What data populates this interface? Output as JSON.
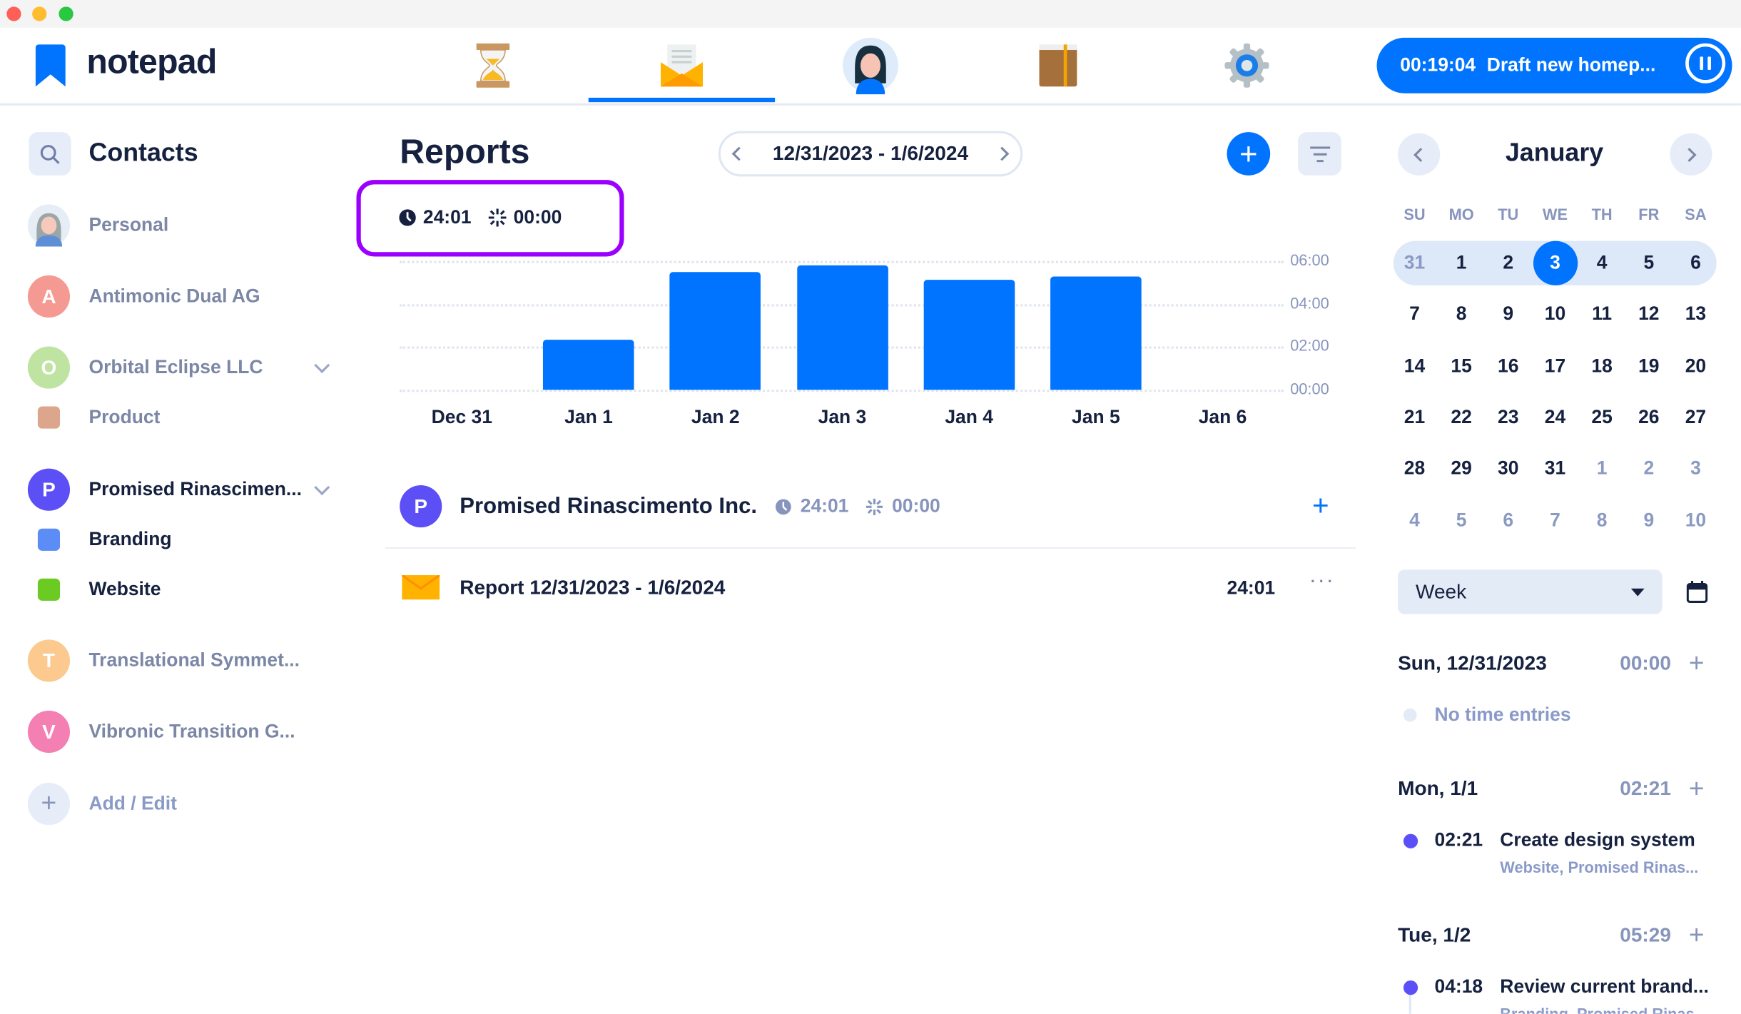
{
  "app": {
    "name": "notepad",
    "brand_color": "#0074ff"
  },
  "nav": {
    "tabs": [
      {
        "icon": "hourglass-icon",
        "active": false
      },
      {
        "icon": "envelope-icon",
        "active": true
      },
      {
        "icon": "avatar-icon",
        "active": false
      },
      {
        "icon": "book-icon",
        "active": false
      },
      {
        "icon": "gear-icon",
        "active": false
      }
    ]
  },
  "timer": {
    "time": "00:19:04",
    "task": "Draft new homep..."
  },
  "sidebar": {
    "title": "Contacts",
    "items": [
      {
        "label": "Personal",
        "type": "avatar-photo",
        "muted": true
      },
      {
        "label": "Antimonic Dual AG",
        "initial": "A",
        "color": "#f59a93",
        "muted": true
      },
      {
        "label": "Orbital Eclipse LLC",
        "initial": "O",
        "color": "#bfe3a1",
        "muted": true,
        "expandable": true
      },
      {
        "label": "Product",
        "color": "#dba68b",
        "muted": true,
        "project": true
      },
      {
        "label": "Promised Rinascimen...",
        "initial": "P",
        "color": "#5b4ff5",
        "muted": false,
        "expandable": true
      },
      {
        "label": "Branding",
        "color": "#5c8df6",
        "muted": false,
        "project": true
      },
      {
        "label": "Website",
        "color": "#6bcb23",
        "muted": false,
        "project": true
      },
      {
        "label": "Translational Symmet...",
        "initial": "T",
        "color": "#fcc98f",
        "muted": true
      },
      {
        "label": "Vibronic Transition G...",
        "initial": "V",
        "color": "#f47fb3",
        "muted": true
      }
    ],
    "add_label": "Add / Edit"
  },
  "main": {
    "title": "Reports",
    "date_range": "12/31/2023 - 1/6/2024",
    "total_time": "24:01",
    "break_time": "00:00",
    "client": {
      "initial": "P",
      "name": "Promised Rinascimento Inc.",
      "time": "24:01",
      "break": "00:00"
    },
    "report": {
      "name": "Report 12/31/2023 - 1/6/2024",
      "time": "24:01"
    }
  },
  "chart_data": {
    "type": "bar",
    "categories": [
      "Dec 31",
      "Jan 1",
      "Jan 2",
      "Jan 3",
      "Jan 4",
      "Jan 5",
      "Jan 6"
    ],
    "values_hours": [
      0,
      2.35,
      5.48,
      5.8,
      5.1,
      5.28,
      0
    ],
    "y_ticks": [
      "00:00",
      "02:00",
      "04:00",
      "06:00"
    ],
    "ylim_hours": [
      0,
      6
    ],
    "grid": true,
    "bar_color": "#0074ff"
  },
  "calendar": {
    "month": "January",
    "weekdays": [
      "SU",
      "MO",
      "TU",
      "WE",
      "TH",
      "FR",
      "SA"
    ],
    "weeks": [
      [
        "31",
        "1",
        "2",
        "3",
        "4",
        "5",
        "6"
      ],
      [
        "7",
        "8",
        "9",
        "10",
        "11",
        "12",
        "13"
      ],
      [
        "14",
        "15",
        "16",
        "17",
        "18",
        "19",
        "20"
      ],
      [
        "21",
        "22",
        "23",
        "24",
        "25",
        "26",
        "27"
      ],
      [
        "28",
        "29",
        "30",
        "31",
        "1",
        "2",
        "3"
      ],
      [
        "4",
        "5",
        "6",
        "7",
        "8",
        "9",
        "10"
      ]
    ],
    "today": "3",
    "selected_week_index": 0,
    "view": "Week"
  },
  "days": [
    {
      "label": "Sun, 12/31/2023",
      "total": "00:00",
      "empty_text": "No time entries",
      "entries": []
    },
    {
      "label": "Mon, 1/1",
      "total": "02:21",
      "entries": [
        {
          "time": "02:21",
          "title": "Create design system",
          "sub": "Website, Promised Rinas..."
        }
      ]
    },
    {
      "label": "Tue, 1/2",
      "total": "05:29",
      "entries": [
        {
          "time": "04:18",
          "title": "Review current brand...",
          "sub": "Branding, Promised Rinas..."
        }
      ]
    }
  ]
}
